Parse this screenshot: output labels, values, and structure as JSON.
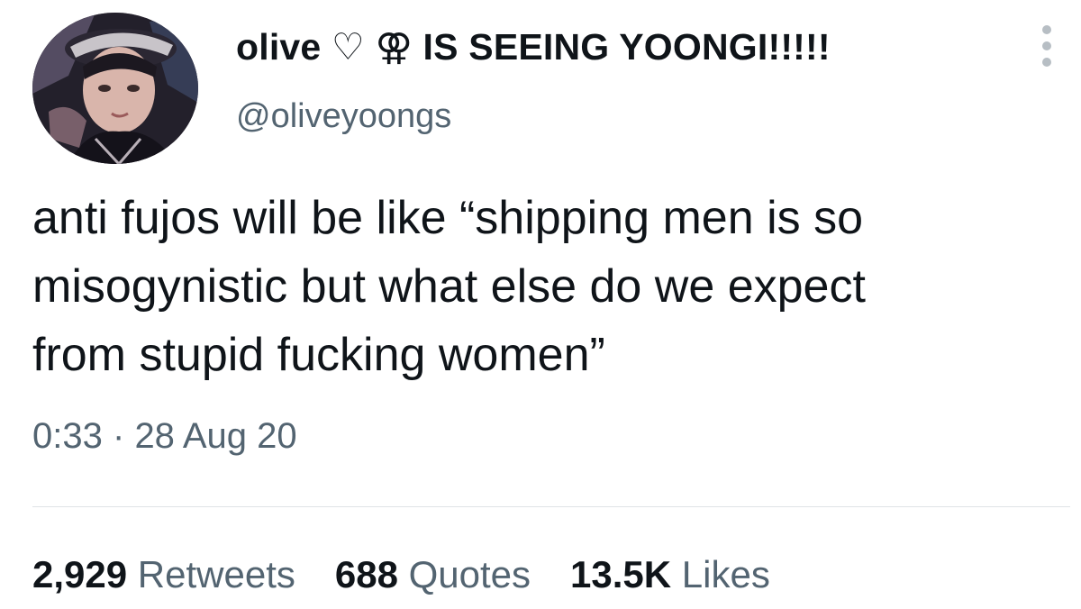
{
  "author": {
    "display_name": "olive ♡ ⚢ IS SEEING YOONGI!!!!!",
    "handle": "@oliveyoongs"
  },
  "tweet": {
    "lines": [
      "anti fujos will be like “shipping  men is so",
      "misogynistic but what else do we expect",
      "from stupid fucking women”"
    ],
    "time": "0:33",
    "separator": "·",
    "date": "28 Aug 20"
  },
  "stats": {
    "retweets_count": "2,929",
    "retweets_label": "Retweets",
    "quotes_count": "688",
    "quotes_label": "Quotes",
    "likes_count": "13.5K",
    "likes_label": "Likes"
  },
  "icons": {
    "more": "more-options-icon",
    "avatar": "profile-avatar"
  },
  "colors": {
    "text": "#0f1419",
    "secondary": "#536471",
    "divider": "#dfe3e6"
  }
}
